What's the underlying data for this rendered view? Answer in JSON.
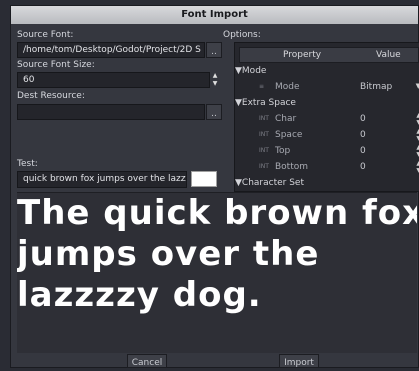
{
  "dialog": {
    "title": "Font Import"
  },
  "left": {
    "source_font_label": "Source Font:",
    "source_font_value": "/home/tom/Desktop/Godot/Project/2D S",
    "browse_label": "..",
    "font_size_label": "Source Font Size:",
    "font_size_value": "60",
    "dest_label": "Dest Resource:",
    "dest_value": "",
    "dest_browse_label": "..",
    "test_label": "Test:",
    "test_value": "quick brown fox jumps over the lazzz"
  },
  "options": {
    "label": "Options:",
    "col_property": "Property",
    "col_value": "Value",
    "rows": [
      {
        "kind": "category",
        "label": "Mode"
      },
      {
        "kind": "prop",
        "icon": "list-icon",
        "name": "Mode",
        "value": "Bitmap",
        "control": "dropdown"
      },
      {
        "kind": "category",
        "label": "Extra Space"
      },
      {
        "kind": "prop",
        "icon": "int-icon",
        "name": "Char",
        "value": "0",
        "control": "spin"
      },
      {
        "kind": "prop",
        "icon": "int-icon",
        "name": "Space",
        "value": "0",
        "control": "spin"
      },
      {
        "kind": "prop",
        "icon": "int-icon",
        "name": "Top",
        "value": "0",
        "control": "spin"
      },
      {
        "kind": "prop",
        "icon": "int-icon",
        "name": "Bottom",
        "value": "0",
        "control": "spin"
      },
      {
        "kind": "category",
        "label": "Character Set"
      }
    ]
  },
  "preview": {
    "lines": [
      "The quick brown fox",
      "jumps over the",
      "lazzzzy dog."
    ]
  },
  "footer": {
    "cancel_label": "Cancel",
    "import_label": "Import"
  },
  "colors": {
    "title_bar": "#c8c9cc",
    "dialog_bg": "#35373f",
    "field_bg": "#24252b",
    "preview_text": "#ffffff"
  },
  "icons": {
    "int_glyph": "INT",
    "list_glyph": "≡"
  }
}
